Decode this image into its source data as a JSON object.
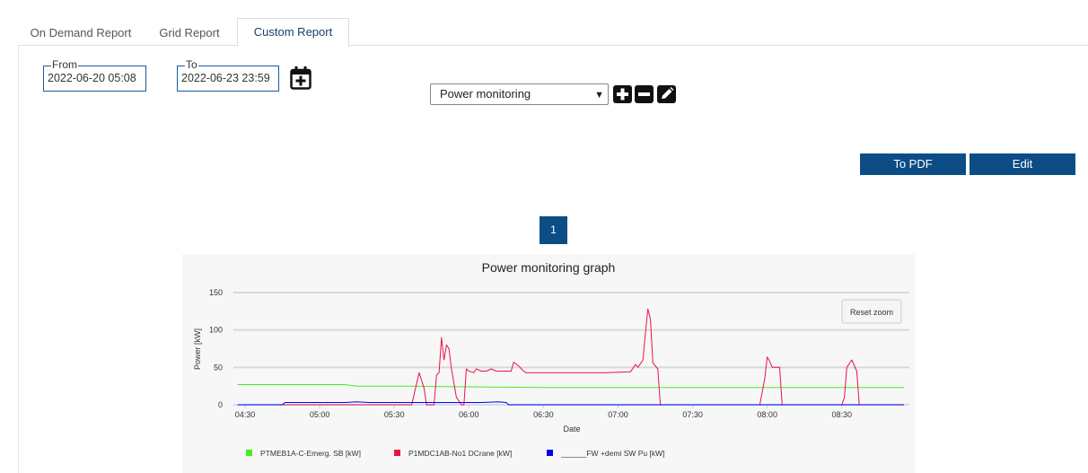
{
  "tabs": [
    {
      "label": "On Demand Report"
    },
    {
      "label": "Grid Report"
    },
    {
      "label": "Custom Report"
    }
  ],
  "date_range": {
    "from_label": "From",
    "from_value": "2022-06-20 05:08",
    "to_label": "To",
    "to_value": "2022-06-23 23:59"
  },
  "report_select": {
    "selected": "Power monitoring"
  },
  "toolbar_icons": [
    "plus-icon",
    "minus-icon",
    "pencil-icon"
  ],
  "buttons": {
    "to_pdf": "To PDF",
    "edit": "Edit"
  },
  "pagination": {
    "current": "1"
  },
  "reset_zoom_label": "Reset zoom",
  "colors": {
    "accent": "#0d4d86",
    "series1": "#44ee22",
    "series2": "#ee1144",
    "series3": "#0000ee"
  },
  "chart_data": {
    "type": "line",
    "title": "Power monitoring graph",
    "xlabel": "Date",
    "ylabel": "Power [kW]",
    "ylim": [
      0,
      150
    ],
    "y_ticks": [
      "0",
      "50",
      "100",
      "150"
    ],
    "x_ticks": [
      "04:30",
      "05:00",
      "05:30",
      "06:00",
      "06:30",
      "07:00",
      "07:30",
      "08:00",
      "08:30"
    ],
    "x_range": [
      "04:30",
      "09:00"
    ],
    "grid": true,
    "legend_position": "bottom",
    "series": [
      {
        "name": "PTMEB1A-C-Emerg. SB [kW]",
        "points": [
          [
            "04:27",
            27
          ],
          [
            "05:00",
            27
          ],
          [
            "05:10",
            27
          ],
          [
            "05:15",
            25
          ],
          [
            "05:35",
            25
          ],
          [
            "06:00",
            24
          ],
          [
            "06:30",
            23
          ],
          [
            "07:00",
            23
          ],
          [
            "07:30",
            23
          ],
          [
            "08:00",
            23
          ],
          [
            "08:30",
            23
          ],
          [
            "08:55",
            23
          ]
        ]
      },
      {
        "name": "P1MDC1AB-No1 DCrane [kW]",
        "points": [
          [
            "04:27",
            0
          ],
          [
            "05:37",
            0
          ],
          [
            "05:40",
            43
          ],
          [
            "05:42",
            22
          ],
          [
            "05:43",
            0
          ],
          [
            "05:46",
            0
          ],
          [
            "05:47",
            40
          ],
          [
            "05:48",
            43
          ],
          [
            "05:49",
            90
          ],
          [
            "05:50",
            60
          ],
          [
            "05:51",
            80
          ],
          [
            "05:52",
            75
          ],
          [
            "05:53",
            48
          ],
          [
            "05:55",
            10
          ],
          [
            "05:57",
            0
          ],
          [
            "05:58",
            0
          ],
          [
            "05:59",
            48
          ],
          [
            "06:00",
            45
          ],
          [
            "06:02",
            43
          ],
          [
            "06:03",
            48
          ],
          [
            "06:05",
            45
          ],
          [
            "06:07",
            45
          ],
          [
            "06:09",
            48
          ],
          [
            "06:11",
            45
          ],
          [
            "06:17",
            45
          ],
          [
            "06:18",
            57
          ],
          [
            "06:20",
            52
          ],
          [
            "06:22",
            45
          ],
          [
            "06:23",
            43
          ],
          [
            "06:40",
            43
          ],
          [
            "06:55",
            43
          ],
          [
            "07:05",
            44
          ],
          [
            "07:07",
            54
          ],
          [
            "07:08",
            50
          ],
          [
            "07:10",
            60
          ],
          [
            "07:11",
            96
          ],
          [
            "07:12",
            128
          ],
          [
            "07:13",
            115
          ],
          [
            "07:14",
            56
          ],
          [
            "07:16",
            48
          ],
          [
            "07:17",
            0
          ],
          [
            "07:57",
            0
          ],
          [
            "07:59",
            35
          ],
          [
            "08:00",
            64
          ],
          [
            "08:01",
            58
          ],
          [
            "08:02",
            50
          ],
          [
            "08:04",
            50
          ],
          [
            "08:05",
            50
          ],
          [
            "08:06",
            0
          ],
          [
            "08:30",
            0
          ],
          [
            "08:31",
            10
          ],
          [
            "08:32",
            50
          ],
          [
            "08:34",
            60
          ],
          [
            "08:36",
            45
          ],
          [
            "08:37",
            0
          ]
        ]
      },
      {
        "name": "______FW +demi SW Pu [kW]",
        "points": [
          [
            "04:27",
            0
          ],
          [
            "04:45",
            0
          ],
          [
            "04:46",
            3
          ],
          [
            "05:00",
            3
          ],
          [
            "05:10",
            3
          ],
          [
            "05:15",
            4
          ],
          [
            "05:20",
            3
          ],
          [
            "05:35",
            3
          ],
          [
            "05:45",
            3
          ],
          [
            "05:55",
            3
          ],
          [
            "06:05",
            3
          ],
          [
            "06:12",
            4
          ],
          [
            "06:15",
            3
          ],
          [
            "06:16",
            0
          ],
          [
            "06:30",
            0
          ],
          [
            "07:00",
            0
          ],
          [
            "07:30",
            0
          ],
          [
            "08:00",
            0
          ],
          [
            "08:30",
            0
          ],
          [
            "08:55",
            0
          ]
        ]
      }
    ]
  }
}
